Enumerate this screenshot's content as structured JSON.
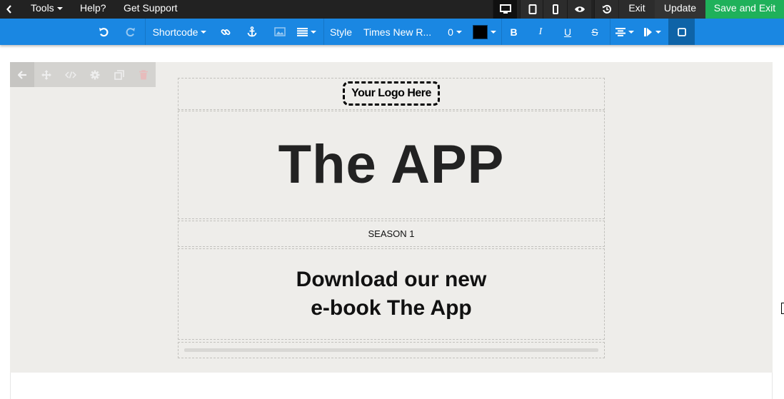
{
  "topbar": {
    "menu": [
      {
        "label": "Tools",
        "has_caret": true
      },
      {
        "label": "Help?",
        "has_caret": false
      },
      {
        "label": "Get Support",
        "has_caret": false
      }
    ],
    "devices": [
      "desktop-icon",
      "tablet-icon",
      "mobile-icon",
      "preview-eye-icon",
      "history-icon"
    ],
    "exit_label": "Exit",
    "update_label": "Update",
    "save_label": "Save and Exit"
  },
  "toolbar": {
    "shortcode_label": "Shortcode",
    "style_label": "Style",
    "font_label": "Times New R...",
    "size_label": "0",
    "text_color": "#000000",
    "bold_label": "B",
    "italic_label": "I",
    "underline_label": "U",
    "strike_label": "S"
  },
  "canvas": {
    "logo_text": "Your Logo Here",
    "headline": "The APP",
    "season": "SEASON 1",
    "cta_line1": "Download our new",
    "cta_line2": "e-book The App"
  },
  "colors": {
    "topbar_bg": "#222222",
    "toolbar_bg": "#1a87e2",
    "save_bg": "#1fb15a",
    "canvas_bg": "#eeedea"
  }
}
